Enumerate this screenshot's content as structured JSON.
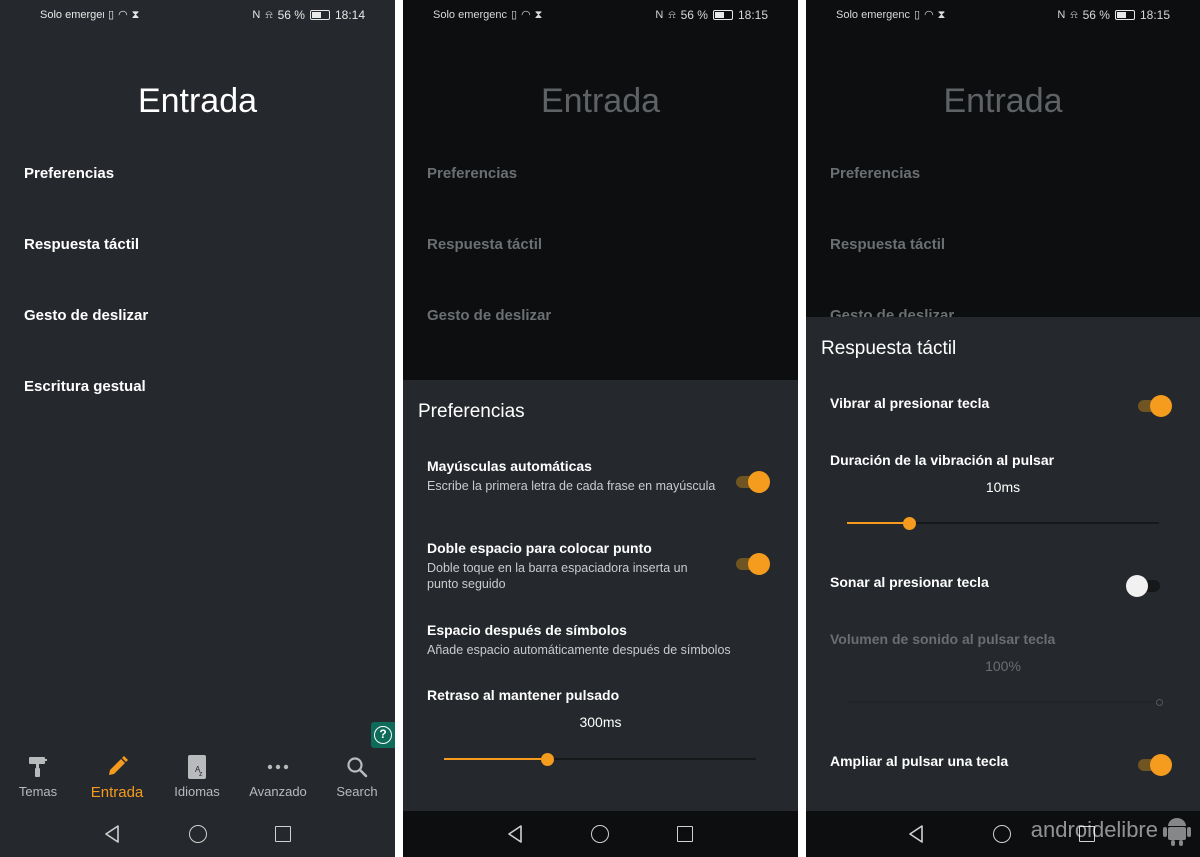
{
  "status_bars": [
    {
      "carrier": "Solo emergenc",
      "battery_pct": "56 %",
      "time": "18:14"
    },
    {
      "carrier": "Solo emergenc...",
      "battery_pct": "56 %",
      "time": "18:15"
    },
    {
      "carrier": "Solo emergenc...",
      "battery_pct": "56 %",
      "time": "18:15"
    }
  ],
  "page": {
    "title": "Entrada",
    "menu": [
      "Preferencias",
      "Respuesta táctil",
      "Gesto de deslizar",
      "Escritura gestual"
    ]
  },
  "tabs": [
    {
      "label": "Temas",
      "icon": "paint-roller-icon",
      "active": false
    },
    {
      "label": "Entrada",
      "icon": "pencil-icon",
      "active": true
    },
    {
      "label": "Idiomas",
      "icon": "language-book-icon",
      "active": false
    },
    {
      "label": "Avanzado",
      "icon": "more-dots-icon",
      "active": false
    },
    {
      "label": "Search",
      "icon": "search-icon",
      "active": false
    }
  ],
  "preferencias_sheet": {
    "title": "Preferencias",
    "items": [
      {
        "title": "Mayúsculas automáticas",
        "subtitle": "Escribe la primera letra de cada frase en mayúscula",
        "on": true
      },
      {
        "title": "Doble espacio para colocar punto",
        "subtitle": "Doble toque en la barra espaciadora inserta un punto seguido",
        "on": true
      },
      {
        "title": "Espacio después de símbolos",
        "subtitle": "Añade espacio automáticamente después de símbolos"
      }
    ],
    "slider": {
      "title": "Retraso al mantener pulsado",
      "value_label": "300ms",
      "fraction": 0.33
    }
  },
  "respuesta_sheet": {
    "title": "Respuesta táctil",
    "vibrar": {
      "title": "Vibrar al presionar tecla",
      "on": true
    },
    "duracion": {
      "title": "Duración de la vibración al pulsar",
      "value_label": "10ms",
      "fraction": 0.2
    },
    "sonar": {
      "title": "Sonar al presionar tecla",
      "on": false
    },
    "volumen": {
      "title": "Volumen de sonido al pulsar tecla",
      "value_label": "100%",
      "fraction": 1.0,
      "disabled": true
    },
    "ampliar": {
      "title": "Ampliar al pulsar una tecla",
      "on": true
    }
  },
  "watermark": "androidelibre",
  "colors": {
    "accent": "#f59b1d",
    "background": "#25282c",
    "dim_overlay": "#0c0e10",
    "help_button": "#0e6b5a"
  }
}
